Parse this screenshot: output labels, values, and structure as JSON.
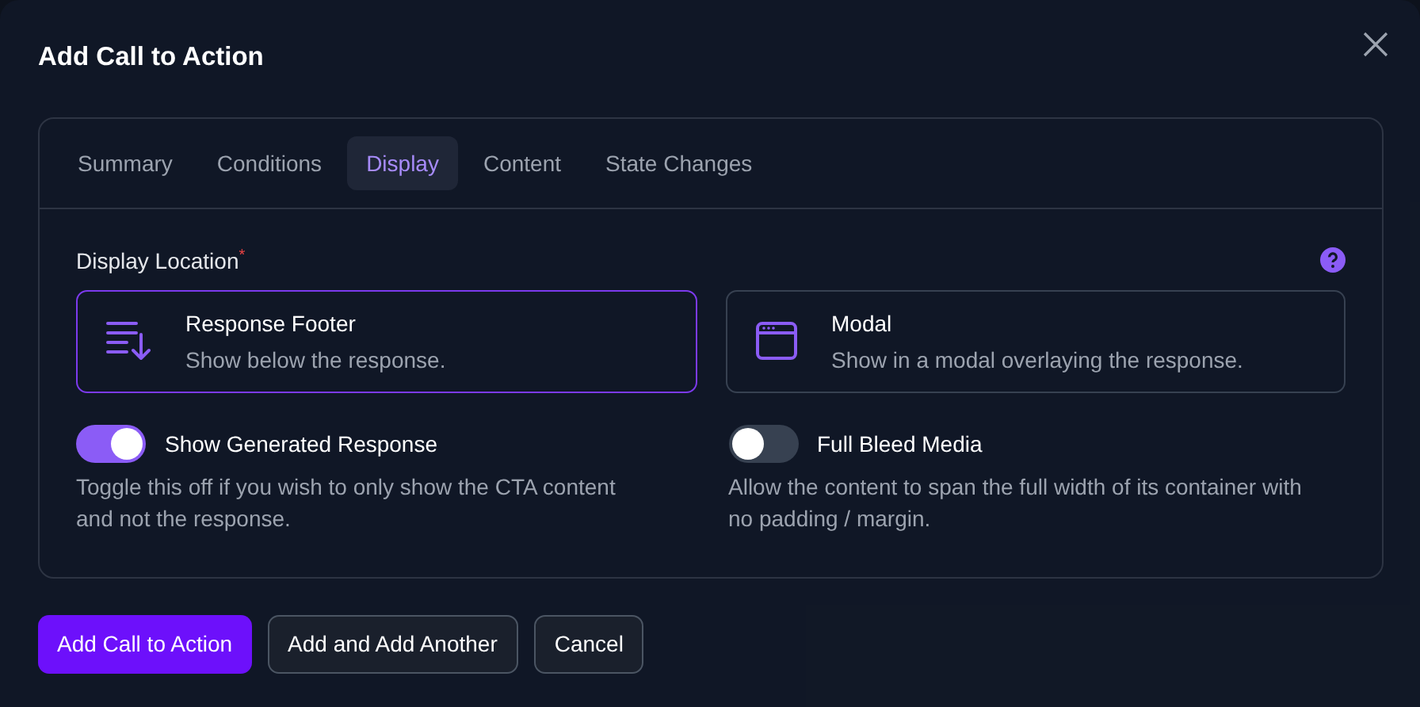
{
  "dialog": {
    "title": "Add Call to Action",
    "tabs": [
      {
        "label": "Summary",
        "selected": false
      },
      {
        "label": "Conditions",
        "selected": false
      },
      {
        "label": "Display",
        "selected": true
      },
      {
        "label": "Content",
        "selected": false
      },
      {
        "label": "State Changes",
        "selected": false
      }
    ],
    "display_location": {
      "label": "Display Location",
      "required_mark": "*",
      "options": [
        {
          "kind": "footer",
          "title": "Response Footer",
          "description": "Show below the response.",
          "selected": true
        },
        {
          "kind": "modal",
          "title": "Modal",
          "description": "Show in a modal overlaying the response.",
          "selected": false
        }
      ]
    },
    "toggles": [
      {
        "label": "Show Generated Response",
        "on": true,
        "description": "Toggle this off if you wish to only show the CTA content and not the response."
      },
      {
        "label": "Full Bleed Media",
        "on": false,
        "description": "Allow the content to span the full width of its container with no padding / margin."
      }
    ],
    "buttons": [
      {
        "label": "Add Call to Action",
        "kind": "primary"
      },
      {
        "label": "Add and Add Another",
        "kind": "secondary"
      },
      {
        "label": "Cancel",
        "kind": "secondary"
      }
    ]
  }
}
